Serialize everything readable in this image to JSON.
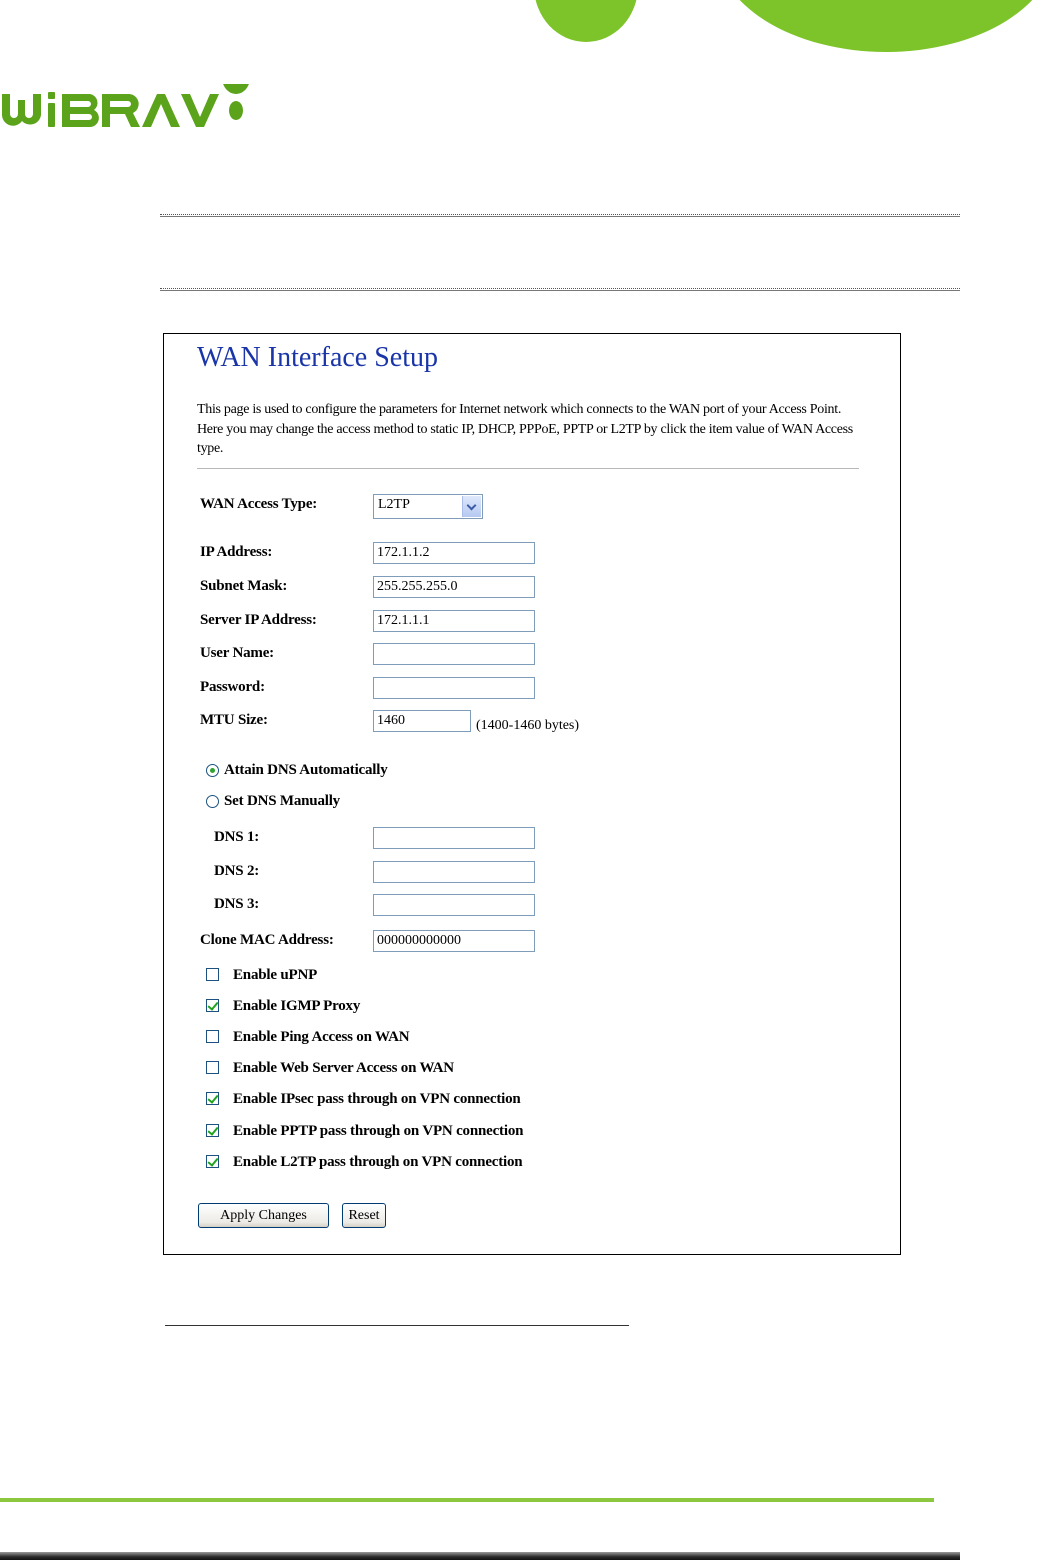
{
  "logo": {
    "text": "WiBRAVO",
    "color": "#5aa31a"
  },
  "page": {
    "title": "WAN Interface Setup",
    "description": "This page is used to configure the parameters for Internet network which connects to the WAN port of your Access Point. Here you may change the access method to static IP, DHCP, PPPoE, PPTP or L2TP by click the item value of WAN Access type."
  },
  "form": {
    "wan_access_type": {
      "label": "WAN Access Type:",
      "value": "L2TP"
    },
    "ip_address": {
      "label": "IP Address:",
      "value": "172.1.1.2"
    },
    "subnet_mask": {
      "label": "Subnet Mask:",
      "value": "255.255.255.0"
    },
    "server_ip": {
      "label": "Server IP Address:",
      "value": "172.1.1.1"
    },
    "user_name": {
      "label": "User Name:",
      "value": ""
    },
    "password": {
      "label": "Password:",
      "value": ""
    },
    "mtu": {
      "label": "MTU Size:",
      "value": "1460",
      "hint": "(1400-1460 bytes)"
    },
    "dns_auto": {
      "label": "Attain DNS Automatically",
      "checked": true
    },
    "dns_manual": {
      "label": "Set DNS Manually",
      "checked": false
    },
    "dns1": {
      "label": "DNS 1:",
      "value": ""
    },
    "dns2": {
      "label": "DNS 2:",
      "value": ""
    },
    "dns3": {
      "label": "DNS 3:",
      "value": ""
    },
    "clone_mac": {
      "label": "Clone MAC Address:",
      "value": "000000000000"
    },
    "options": [
      {
        "label": "Enable uPNP",
        "checked": false
      },
      {
        "label": "Enable IGMP Proxy",
        "checked": true
      },
      {
        "label": "Enable Ping Access on WAN",
        "checked": false
      },
      {
        "label": "Enable Web Server Access on WAN",
        "checked": false
      },
      {
        "label": "Enable IPsec pass through on VPN connection",
        "checked": true
      },
      {
        "label": "Enable PPTP pass through on VPN connection",
        "checked": true
      },
      {
        "label": "Enable L2TP pass through on VPN connection",
        "checked": true
      }
    ],
    "apply_label": "Apply Changes",
    "reset_label": "Reset"
  },
  "colors": {
    "accent_green": "#7dc42a",
    "title_blue": "#1a35a8"
  }
}
